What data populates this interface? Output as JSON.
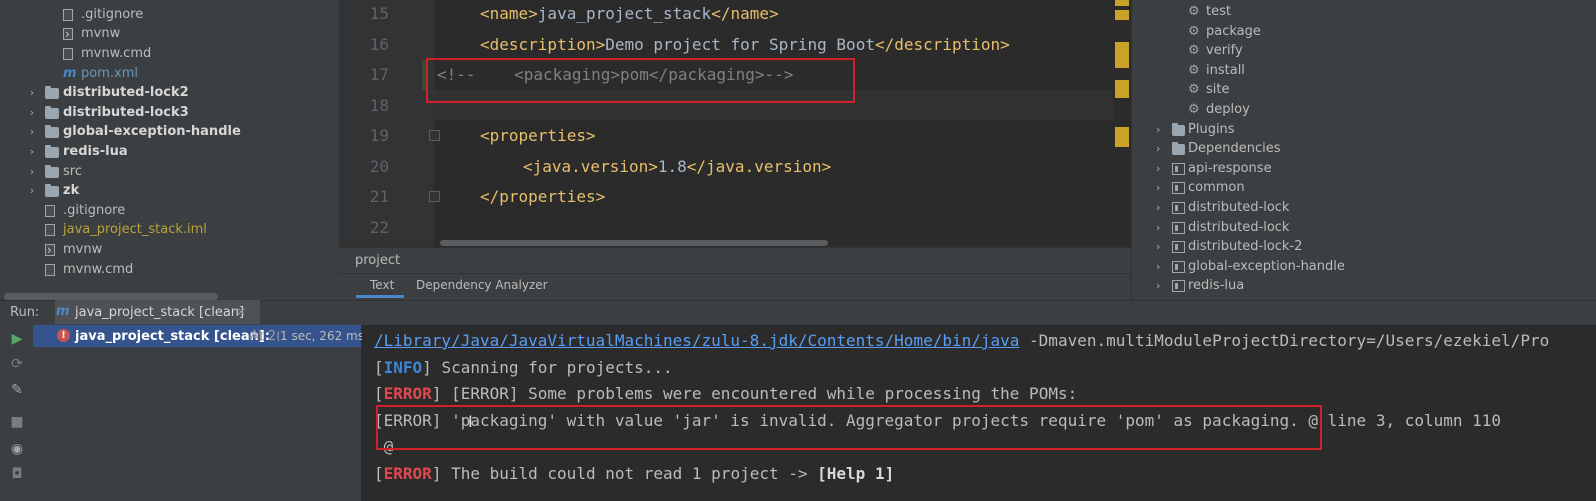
{
  "project_tree": {
    "items": [
      {
        "label": ".gitignore",
        "type": "file"
      },
      {
        "label": "mvnw",
        "type": "script"
      },
      {
        "label": "mvnw.cmd",
        "type": "file"
      },
      {
        "label": "pom.xml",
        "type": "maven"
      },
      {
        "label": "distributed-lock2",
        "type": "module"
      },
      {
        "label": "distributed-lock3",
        "type": "module"
      },
      {
        "label": "global-exception-handle",
        "type": "module"
      },
      {
        "label": "redis-lua",
        "type": "module"
      },
      {
        "label": "src",
        "type": "folder"
      },
      {
        "label": "zk",
        "type": "module"
      },
      {
        "label": ".gitignore",
        "type": "file"
      },
      {
        "label": "java_project_stack.iml",
        "type": "iml"
      },
      {
        "label": "mvnw",
        "type": "script"
      },
      {
        "label": "mvnw.cmd",
        "type": "file"
      }
    ]
  },
  "editor": {
    "lines": [
      {
        "num": "15",
        "open": "<name>",
        "text": "java_project_stack",
        "close": "</name>"
      },
      {
        "num": "16",
        "open": "<description>",
        "text": "Demo project for Spring Boot",
        "close": "</description>"
      },
      {
        "num": "17",
        "comment": "<!--    <packaging>pom</packaging>-->"
      },
      {
        "num": "18"
      },
      {
        "num": "19",
        "open": "<properties>"
      },
      {
        "num": "20",
        "open": "<java.version>",
        "text": "1.8",
        "close": "</java.version>"
      },
      {
        "num": "21",
        "open": "</properties>"
      },
      {
        "num": "22"
      }
    ],
    "breadcrumb": "project",
    "bottom_tabs": [
      "Text",
      "Dependency Analyzer"
    ],
    "active_tab": "Text"
  },
  "maven": {
    "lifecycle": [
      "test",
      "package",
      "verify",
      "install",
      "site",
      "deploy"
    ],
    "groups": [
      "Plugins",
      "Dependencies"
    ],
    "modules": [
      "api-response",
      "common",
      "distributed-lock",
      "distributed-lock",
      "distributed-lock-2",
      "global-exception-handle",
      "redis-lua"
    ]
  },
  "run": {
    "label": "Run:",
    "tab_title": "java_project_stack [clean]",
    "item_name": "java_project_stack [clean]:",
    "item_at": "At 2(",
    "item_time": "1 sec, 262 ms"
  },
  "console": {
    "line1": {
      "path": "/Library/Java/JavaVirtualMachines/zulu-8.jdk/Contents/Home/bin/java",
      "rest": " -Dmaven.multiModuleProjectDirectory=/Users/ezekiel/Pro"
    },
    "line2": {
      "level": "INFO",
      "text": " Scanning for projects..."
    },
    "line3": {
      "level": "ERROR",
      "text": " [ERROR] Some problems were encountered while processing the POMs:"
    },
    "line4": {
      "text": "[ERROR] 'packaging' with value 'jar' is invalid. Aggregator projects require 'pom' as packaging. @ line 3, column 110"
    },
    "line5": {
      "text": " @"
    },
    "line6": {
      "level": "ERROR",
      "text": " The build could not read 1 project -> ",
      "help": "[Help 1]"
    }
  },
  "colors": {
    "error": "#e0484f",
    "info": "#3e86d6",
    "highlight_box": "#d0202a",
    "link": "#589df6"
  }
}
